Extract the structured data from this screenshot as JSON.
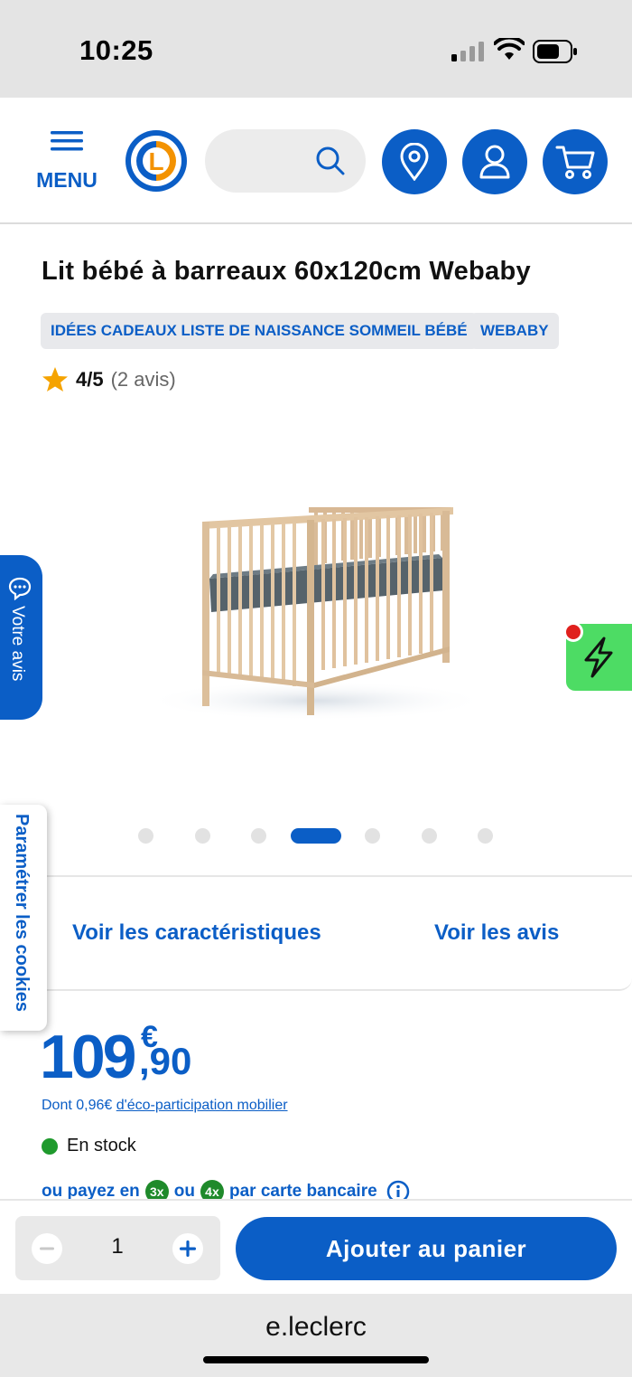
{
  "status_bar": {
    "time": "10:25"
  },
  "header": {
    "menu_label": "MENU",
    "logo_letter": "L"
  },
  "product": {
    "title": "Lit bébé à barreaux 60x120cm Webaby",
    "tags": [
      "IDÉES CADEAUX LISTE DE NAISSANCE SOMMEIL BÉBÉ",
      "WEBABY"
    ],
    "rating_score": "4/5",
    "rating_count": "(2 avis)",
    "rating_value": 4,
    "rating_max": 5
  },
  "gallery": {
    "total_images": 7,
    "active_index": 3
  },
  "side_tabs": {
    "feedback": "Votre avis",
    "cookies": "Paramétrer les cookies"
  },
  "tabs": {
    "characteristics": "Voir les caractéristiques",
    "reviews": "Voir les avis"
  },
  "price": {
    "integer": "109",
    "currency": "€",
    "decimal": ",90",
    "eco_prefix": "Dont 0,96€",
    "eco_link": "d'éco-participation mobilier"
  },
  "stock": {
    "label": "En stock",
    "color": "#1f9a2d"
  },
  "payment": {
    "prefix": "ou payez en",
    "option1": "3x",
    "middle": "ou",
    "option2": "4x",
    "suffix": "par carte bancaire"
  },
  "cart": {
    "quantity": "1",
    "add_label": "Ajouter au panier"
  },
  "browser": {
    "url": "e.leclerc"
  },
  "colors": {
    "brand_blue": "#0b5ec6",
    "brand_orange": "#f39200",
    "flash_green": "#4ddc64",
    "stock_green": "#1f9a2d"
  },
  "icons": [
    "menu-icon",
    "search-icon",
    "location-pin-icon",
    "user-icon",
    "cart-icon",
    "star-icon",
    "chat-bubble-icon",
    "lightning-icon",
    "info-icon",
    "minus-icon",
    "plus-icon"
  ]
}
